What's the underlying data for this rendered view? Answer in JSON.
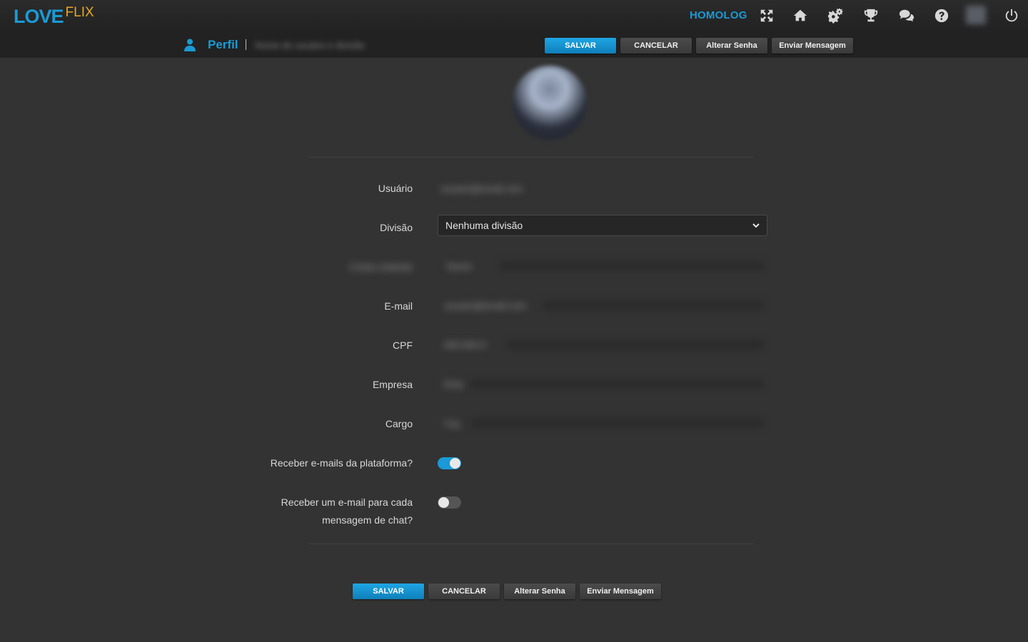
{
  "app": {
    "logo_main": "LOVE",
    "logo_accent": "FLIX",
    "environment": "HOMOLOG",
    "icons": [
      "fullscreen-icon",
      "home-icon",
      "settings-gears-icon",
      "trophy-icon",
      "chat-icon",
      "help-icon",
      "power-icon"
    ]
  },
  "page": {
    "title": "Perfil",
    "subtitle": "Nome do usuário e divisão"
  },
  "actions": {
    "save": "SALVAR",
    "cancel": "CANCELAR",
    "change_password": "Alterar Senha",
    "send_message": "Enviar Mensagem"
  },
  "form": {
    "username_label": "Usuário",
    "username_value": "usuario@email.com",
    "division_label": "Divisão",
    "division_value": "Nenhuma divisão",
    "nickname_label": "Como chamar",
    "nickname_value": "Nome",
    "email_label": "E-mail",
    "email_value": "usuario@email.com",
    "cpf_label": "CPF",
    "cpf_value": "000.000-0",
    "company_label": "Empresa",
    "company_value": "Emp",
    "role_label": "Cargo",
    "role_value": "Crg",
    "receive_emails_label": "Receber e-mails da plataforma?",
    "receive_emails_on": true,
    "chat_email_label_line1": "Receber um e-mail para cada",
    "chat_email_label_line2": "mensagem de chat?",
    "chat_email_on": false
  },
  "colors": {
    "accent": "#1a9ad6",
    "logo_accent": "#e6a81e",
    "background": "#333333",
    "topbar": "#222222"
  }
}
